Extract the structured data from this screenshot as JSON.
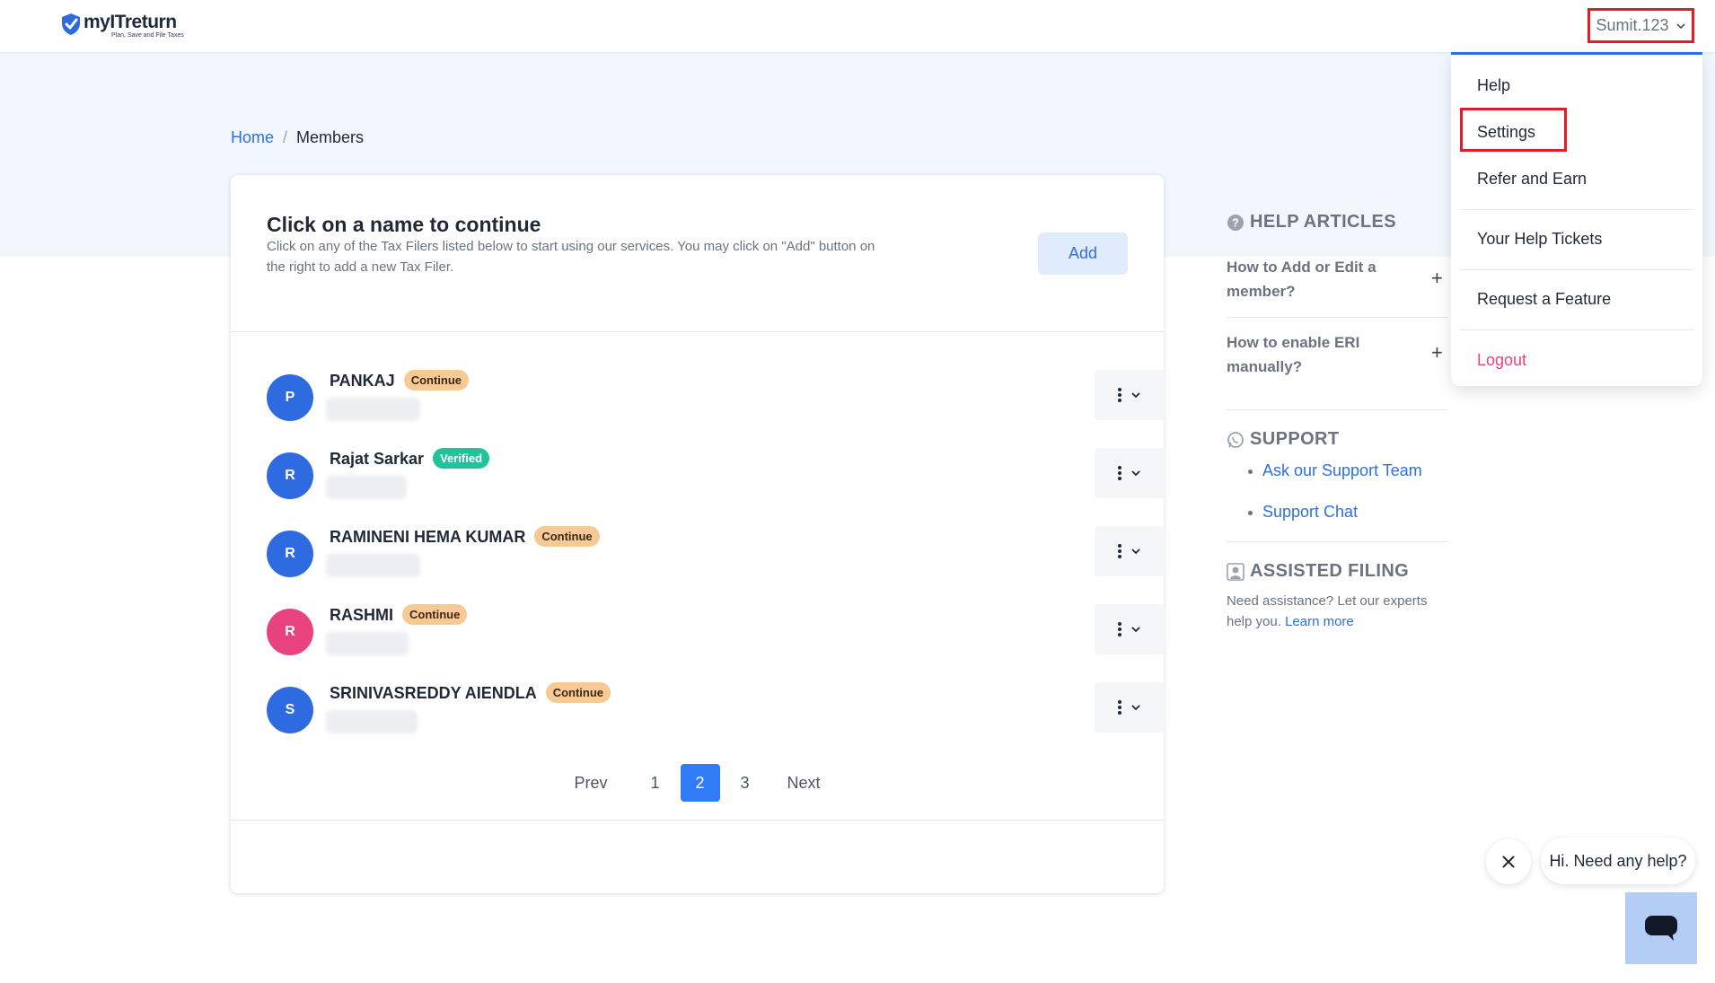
{
  "brand": {
    "name": "myITreturn",
    "tagline": "Plan, Save and File Taxes"
  },
  "header": {
    "user_label": "Sumit.123"
  },
  "user_menu": {
    "items": [
      {
        "label": "Help"
      },
      {
        "label": "Settings"
      },
      {
        "label": "Refer and Earn"
      },
      {
        "label": "Your Help Tickets"
      },
      {
        "label": "Request a Feature"
      },
      {
        "label": "Logout"
      }
    ]
  },
  "breadcrumb": {
    "home": "Home",
    "separator": "/",
    "current": "Members"
  },
  "members_card": {
    "title": "Click on a name to continue",
    "description": "Click on any of the Tax Filers listed below to start using our services. You may click on \"Add\" button on the right to add a new Tax Filer.",
    "add_label": "Add",
    "members": [
      {
        "initial": "P",
        "name": "PANKAJ",
        "status": "Continue",
        "avatar_color": "#2f6be0"
      },
      {
        "initial": "R",
        "name": "Rajat Sarkar",
        "status": "Verified",
        "avatar_color": "#2f6be0"
      },
      {
        "initial": "R",
        "name": "RAMINENI HEMA KUMAR",
        "status": "Continue",
        "avatar_color": "#2f6be0"
      },
      {
        "initial": "R",
        "name": "RASHMI",
        "status": "Continue",
        "avatar_color": "#e8437d"
      },
      {
        "initial": "S",
        "name": "SRINIVASREDDY AIENDLA",
        "status": "Continue",
        "avatar_color": "#2f6be0"
      }
    ]
  },
  "pagination": {
    "prev": "Prev",
    "pages": [
      "1",
      "2",
      "3"
    ],
    "current": "2",
    "next": "Next"
  },
  "sidebar": {
    "help_title": "HELP ARTICLES",
    "articles": [
      {
        "question": "How to Add or Edit a member?"
      },
      {
        "question": "How to enable ERI manually?"
      }
    ],
    "support_title": "SUPPORT",
    "support_links": [
      "Ask our Support Team",
      "Support Chat"
    ],
    "assisted_title": "ASSISTED FILING",
    "assisted_text": "Need assistance? Let our experts help you.",
    "assisted_link": "Learn more"
  },
  "chat": {
    "prompt": "Hi. Need any help?"
  }
}
